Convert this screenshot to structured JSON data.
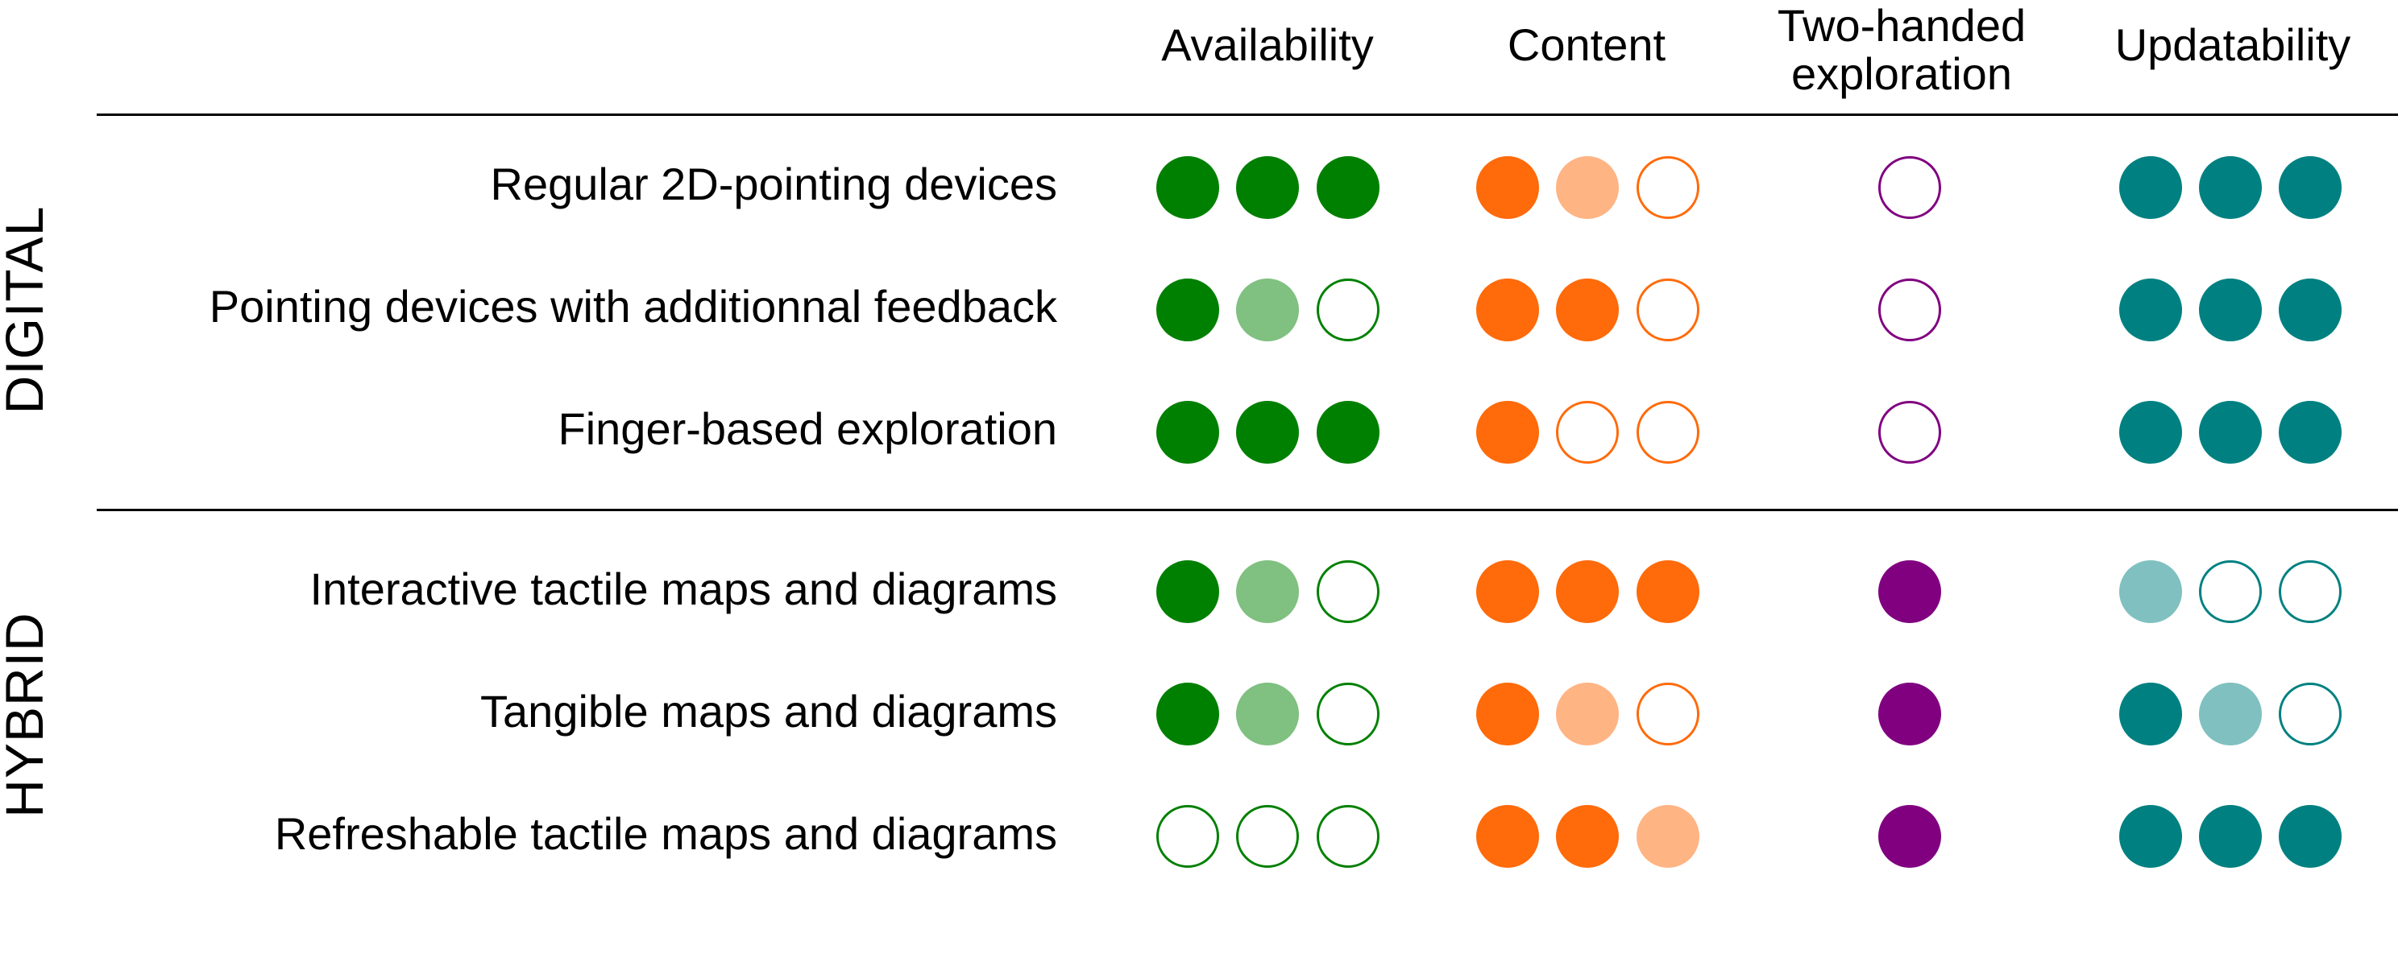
{
  "columns": [
    {
      "id": "availability",
      "label": "Availability"
    },
    {
      "id": "content",
      "label": "Content"
    },
    {
      "id": "two_handed",
      "label": "Two-handed exploration"
    },
    {
      "id": "updatability",
      "label": "Updatability"
    }
  ],
  "colors": {
    "availability": {
      "full": "#008000",
      "half": "#80c080",
      "stroke": "#008000"
    },
    "content": {
      "full": "#ff6a0a",
      "half": "#ffb484",
      "stroke": "#ff6a0a"
    },
    "two_handed": {
      "full": "#800080",
      "half": "#c080c0",
      "stroke": "#800080"
    },
    "updatability": {
      "full": "#008080",
      "half": "#80c0c0",
      "stroke": "#008080"
    }
  },
  "groups": [
    {
      "label": "DIGITAL",
      "rows": [
        {
          "label": "Regular 2D-pointing devices",
          "availability": [
            2,
            2,
            2
          ],
          "content": [
            2,
            1,
            0
          ],
          "two_handed": [
            0
          ],
          "updatability": [
            2,
            2,
            2
          ]
        },
        {
          "label": "Pointing devices with additionnal feedback",
          "availability": [
            2,
            1,
            0
          ],
          "content": [
            2,
            2,
            0
          ],
          "two_handed": [
            0
          ],
          "updatability": [
            2,
            2,
            2
          ]
        },
        {
          "label": "Finger-based exploration",
          "availability": [
            2,
            2,
            2
          ],
          "content": [
            2,
            0,
            0
          ],
          "two_handed": [
            0
          ],
          "updatability": [
            2,
            2,
            2
          ]
        }
      ]
    },
    {
      "label": "HYBRID",
      "rows": [
        {
          "label": "Interactive tactile maps and diagrams",
          "availability": [
            2,
            1,
            0
          ],
          "content": [
            2,
            2,
            2
          ],
          "two_handed": [
            2
          ],
          "updatability": [
            1,
            0,
            0
          ]
        },
        {
          "label": "Tangible maps and diagrams",
          "availability": [
            2,
            1,
            0
          ],
          "content": [
            2,
            1,
            0
          ],
          "two_handed": [
            2
          ],
          "updatability": [
            2,
            1,
            0
          ]
        },
        {
          "label": "Refreshable tactile maps and diagrams",
          "availability": [
            0,
            0,
            0
          ],
          "content": [
            2,
            2,
            1
          ],
          "two_handed": [
            2
          ],
          "updatability": [
            2,
            2,
            2
          ]
        }
      ]
    }
  ]
}
